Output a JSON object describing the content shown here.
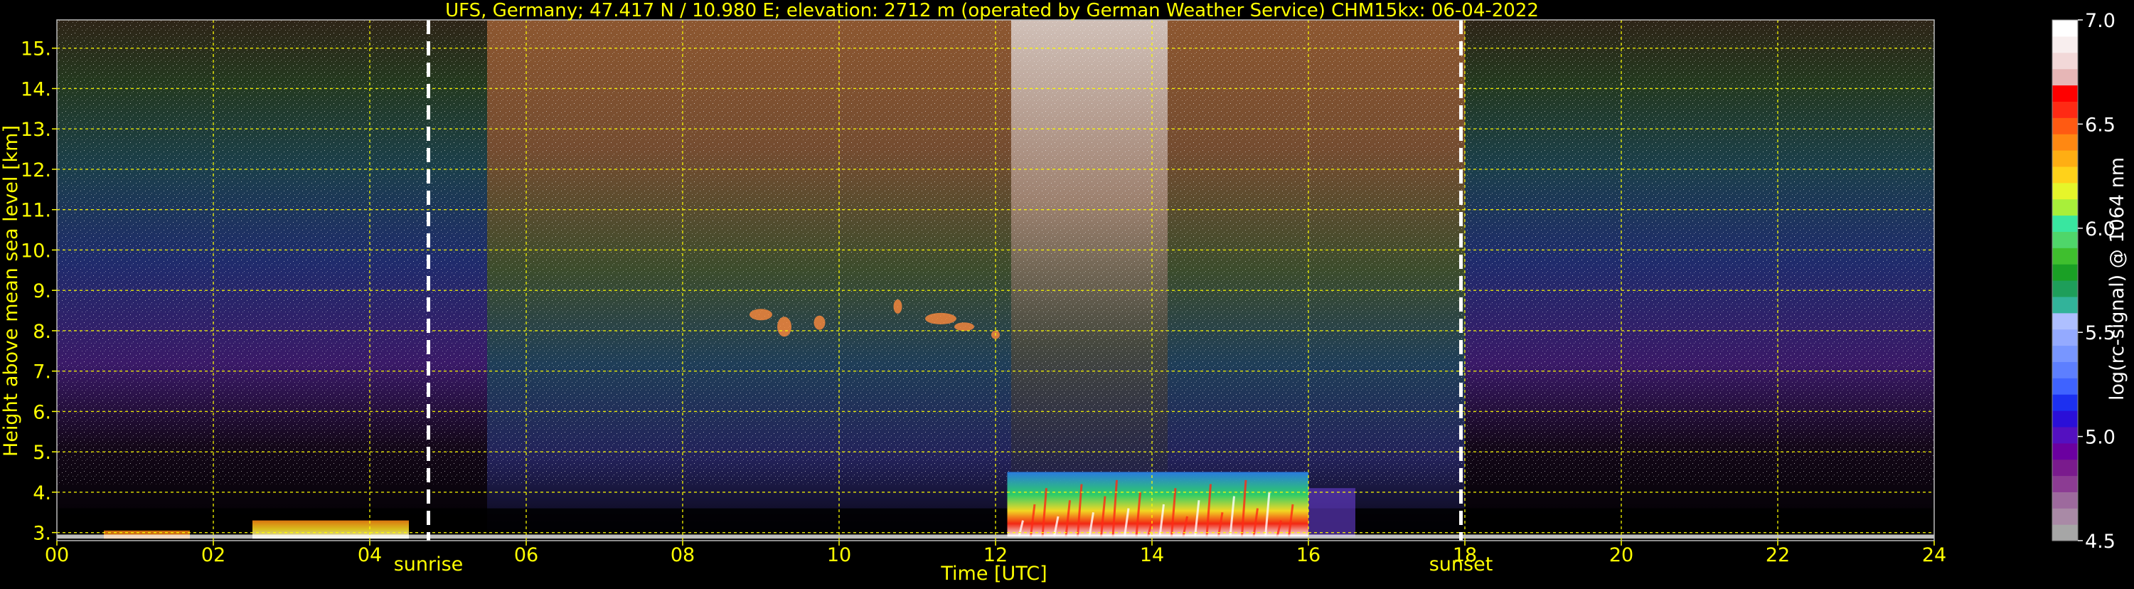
{
  "colors": {
    "background": "#000000",
    "text_yellow": "#ffff00",
    "text_white": "#ffffff",
    "grid": "#ffff00",
    "event_line": "#ffffff"
  },
  "chart_data": {
    "type": "heatmap",
    "title": "UFS, Germany; 47.417 N / 10.980 E; elevation: 2712 m  (operated by German Weather Service)    CHM15kx: 06-04-2022",
    "xlabel": "Time [UTC]",
    "ylabel": "Height above mean sea level [km]",
    "xlim": [
      0,
      24
    ],
    "ylim": [
      2.8,
      15.7
    ],
    "x_ticks": [
      0,
      2,
      4,
      6,
      8,
      10,
      12,
      14,
      16,
      18,
      20,
      22,
      24
    ],
    "x_tick_labels": [
      "00",
      "02",
      "04",
      "06",
      "08",
      "10",
      "12",
      "14",
      "16",
      "18",
      "20",
      "22",
      "24"
    ],
    "y_ticks": [
      3,
      4,
      5,
      6,
      7,
      8,
      9,
      10,
      11,
      12,
      13,
      14,
      15
    ],
    "y_tick_labels": [
      "3.",
      "4.",
      "5.",
      "6.",
      "7.",
      "8.",
      "9.",
      "10.",
      "11.",
      "12.",
      "13.",
      "14.",
      "15."
    ],
    "grid": true,
    "events": [
      {
        "label": "sunrise",
        "time": 4.75
      },
      {
        "label": "sunset",
        "time": 17.95
      }
    ],
    "colorbar": {
      "label": "log(rc-signal) @ 1064 nm",
      "min": 4.5,
      "max": 7.0,
      "ticks": [
        4.5,
        5.0,
        5.5,
        6.0,
        6.5,
        7.0
      ],
      "tick_labels": [
        "4.5",
        "5.0",
        "5.5",
        "6.0",
        "6.5",
        "7.0"
      ],
      "palette": [
        "#a6a6a6",
        "#a98aa6",
        "#9d6a9d",
        "#8c3c93",
        "#7a1b8d",
        "#6b00a0",
        "#5410c0",
        "#2a0fd8",
        "#1c30f0",
        "#3f63ff",
        "#5d7fff",
        "#7896ff",
        "#94aaff",
        "#aebfff",
        "#32b39a",
        "#1e9e5a",
        "#1aa025",
        "#3fbf2e",
        "#4fd66a",
        "#39e6a0",
        "#a8ef3a",
        "#e6f52a",
        "#ffd21a",
        "#ffae13",
        "#ff8812",
        "#ff5a12",
        "#ff2a14",
        "#ff0000",
        "#e6b6b6",
        "#f2d8d8",
        "#f8eeee",
        "#ffffff"
      ]
    },
    "features": [
      {
        "name": "background noise, night",
        "time": [
          0,
          5.5
        ],
        "height": [
          3.0,
          15.7
        ],
        "gradient": "dark brown aloft through green and blue to purple, near black below 4.5 km"
      },
      {
        "name": "background noise, daytime",
        "time": [
          5.5,
          18.0
        ],
        "height": [
          3.0,
          15.7
        ],
        "gradient": "bright orange and white noise aloft, strongest 12-14 UTC"
      },
      {
        "name": "thin cloud",
        "time": [
          8.8,
          12.0
        ],
        "height": [
          7.6,
          9.0
        ],
        "level": "6.5"
      },
      {
        "name": "boundary layer signal",
        "time": [
          12.1,
          16.6
        ],
        "height": [
          2.8,
          4.5
        ],
        "level": "6.0-7.0"
      },
      {
        "name": "surface layer",
        "time": [
          2.5,
          4.5
        ],
        "height": [
          2.8,
          3.3
        ],
        "level": "6.0-6.5"
      }
    ]
  }
}
